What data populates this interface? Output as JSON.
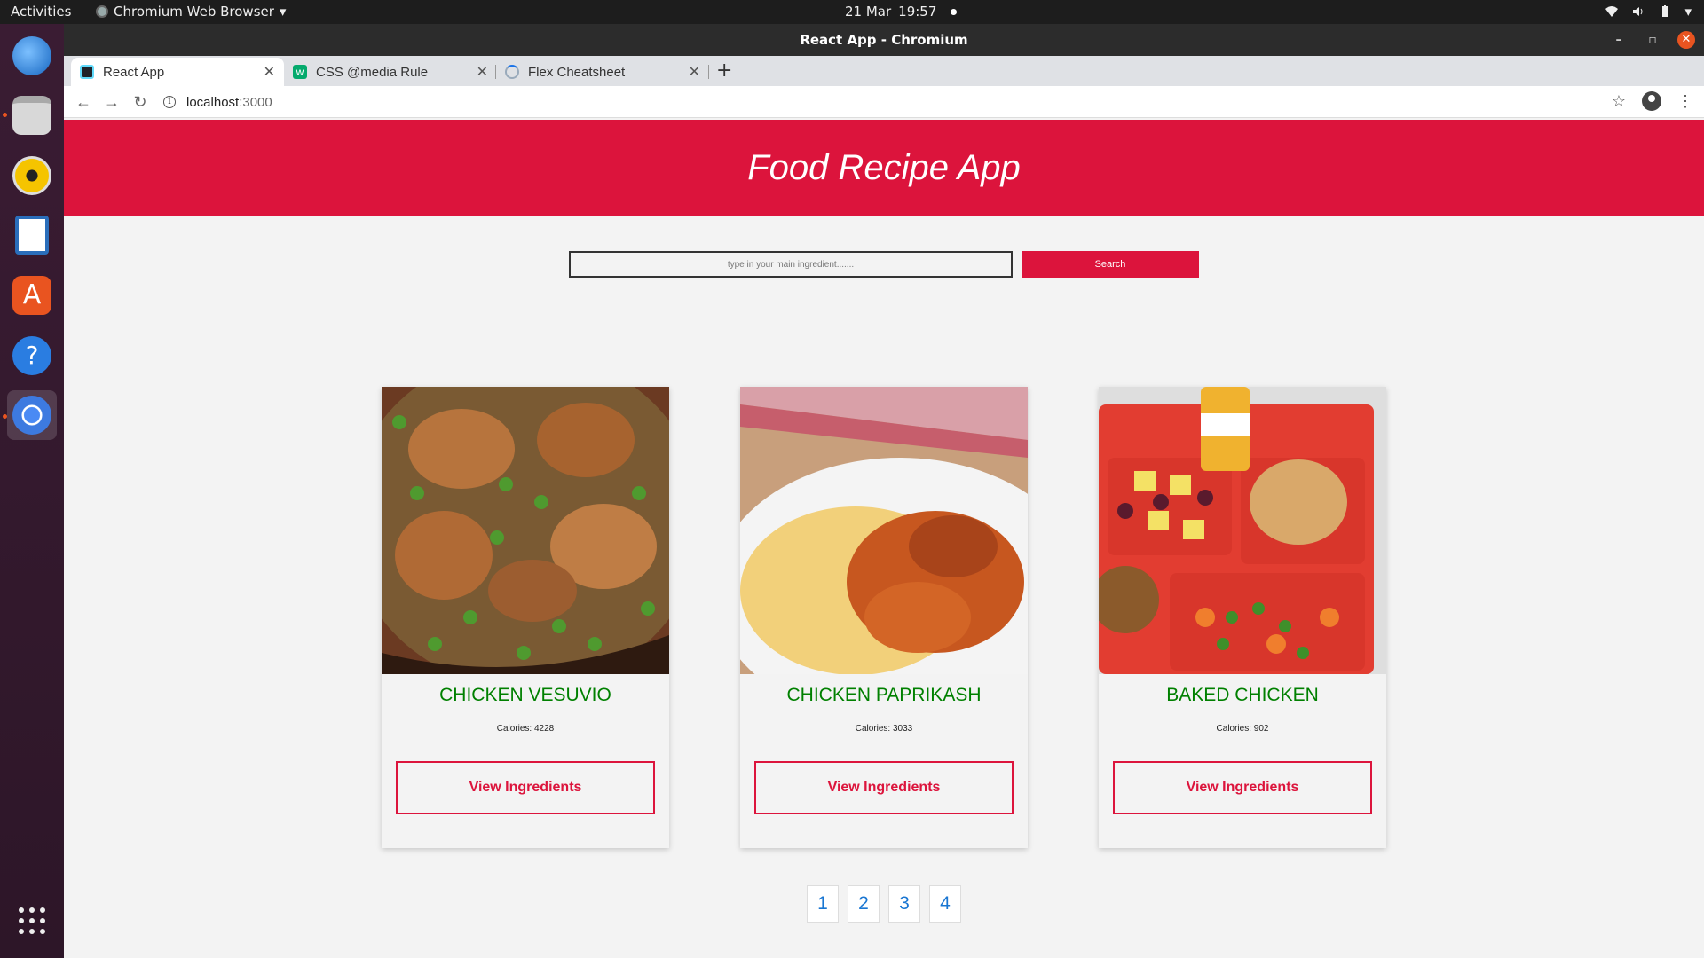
{
  "system": {
    "activities": "Activities",
    "app_menu": "Chromium Web Browser",
    "date": "21 Mar",
    "time": "19:57"
  },
  "dock": [
    "thunderbird-icon",
    "files-icon",
    "rhythmbox-icon",
    "libreoffice-writer-icon",
    "software-center-icon",
    "help-icon",
    "chromium-icon",
    "app-grid-icon"
  ],
  "window": {
    "title": "React App - Chromium"
  },
  "tabs": [
    {
      "label": "React App",
      "favicon": "react-icon"
    },
    {
      "label": "CSS @media Rule",
      "favicon": "w3schools-icon"
    },
    {
      "label": "Flex Cheatsheet",
      "favicon": "loading-icon"
    }
  ],
  "address": {
    "host": "localhost",
    "port": ":3000"
  },
  "app": {
    "title": "Food Recipe App",
    "search_placeholder": "type in your main ingredient.......",
    "search_label": "Search"
  },
  "recipes": [
    {
      "title": "CHICKEN VESUVIO",
      "calories": "Calories: 4228",
      "button": "View Ingredients"
    },
    {
      "title": "CHICKEN PAPRIKASH",
      "calories": "Calories: 3033",
      "button": "View Ingredients"
    },
    {
      "title": "BAKED CHICKEN",
      "calories": "Calories: 902",
      "button": "View Ingredients"
    }
  ],
  "pagination": [
    "1",
    "2",
    "3",
    "4"
  ],
  "colors": {
    "accent": "#dc143c",
    "title_green": "#008000",
    "link_blue": "#1976d2"
  }
}
